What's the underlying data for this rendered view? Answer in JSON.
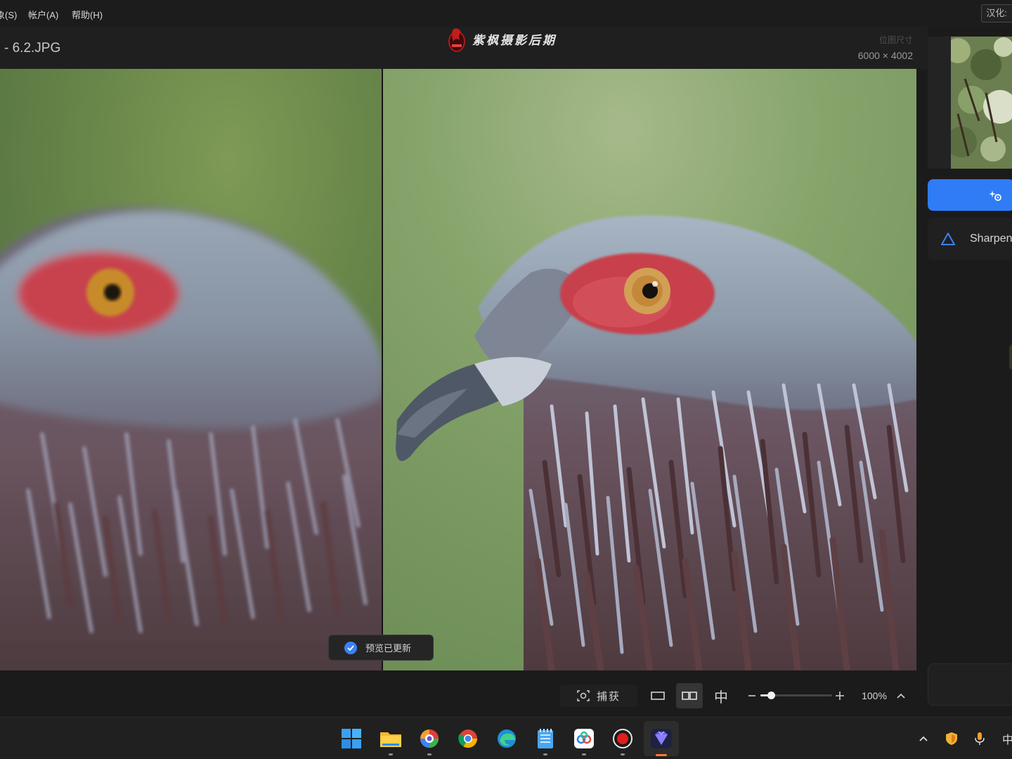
{
  "menu": {
    "items": [
      {
        "label": "象(S)"
      },
      {
        "label": "帐户(A)"
      },
      {
        "label": "帮助(H)"
      }
    ],
    "lang_button": "汉化:"
  },
  "title": {
    "filename": "- 6.2.JPG",
    "watermark": "紫枫摄影后期",
    "dim_label": "位图尺寸",
    "dim_value": "6000 × 4002"
  },
  "viewer": {
    "toast": "预览已更新"
  },
  "panel": {
    "model_label": "Sharpen"
  },
  "toolbar": {
    "capture_label": "捕获",
    "center_glyph": "中",
    "zoom_value": "100%",
    "zoom_level": 0.15
  },
  "taskbar": {
    "input_method": "中"
  },
  "colors": {
    "accent": "#2f7cf6",
    "active_indicator": "#ff7a3c"
  }
}
